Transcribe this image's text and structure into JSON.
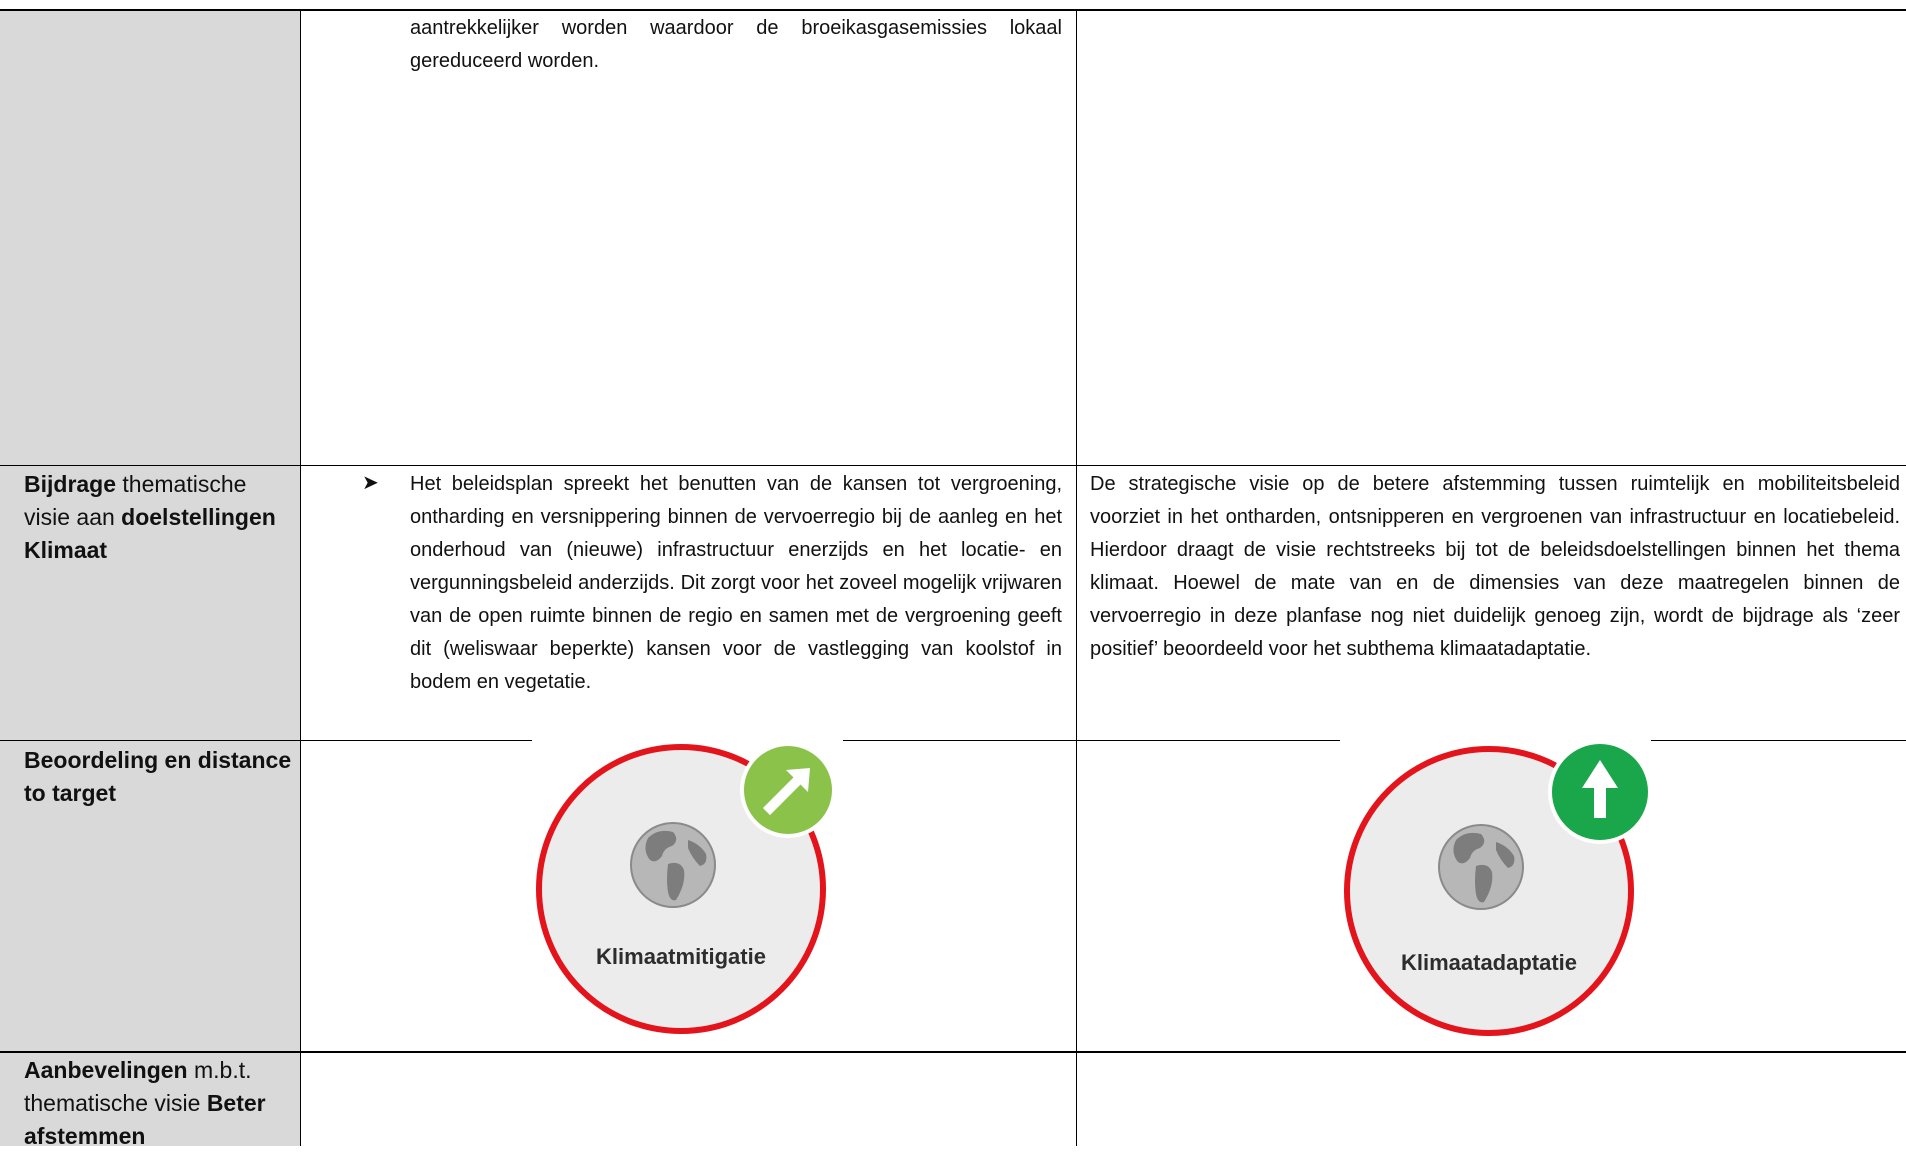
{
  "rows": {
    "top": {
      "left_text": "aantrekkelijker worden waardoor de broeikasgasemissies lokaal gereduceerd worden."
    },
    "bijdrage": {
      "label_bold1": "Bijdrage",
      "label_normal1": " thematische visie aan ",
      "label_bold2": "doelstellingen Klimaat",
      "left_text": "Het beleidsplan spreekt het benutten van de kansen tot vergroening, ontharding en versnippering binnen de vervoerregio bij de aanleg en het onderhoud van (nieuwe) infrastructuur enerzijds en het locatie- en vergunningsbeleid anderzijds. Dit zorgt voor het zoveel mogelijk vrijwaren van de open ruimte binnen de regio en samen met de vergroening geeft dit (weliswaar beperkte) kansen voor de vastlegging van koolstof in bodem en vegetatie.",
      "right_text": "De strategische visie op de betere afstemming tussen ruimtelijk en mobiliteitsbeleid voorziet in het ontharden, ontsnipperen en vergroenen van infrastructuur en locatiebeleid. Hierdoor draagt de visie rechtstreeks bij tot de beleidsdoelstellingen binnen het thema klimaat. Hoewel de mate van en de dimensies van deze maatregelen binnen de vervoerregio in deze planfase nog niet duidelijk genoeg zijn, wordt de bijdrage als ‘zeer positief’ beoordeeld voor het subthema klimaatadaptatie."
    },
    "beoordeling": {
      "label": "Beoordeling en distance to target",
      "left_badge": {
        "text": "Klimaatmitigatie",
        "arrow": "arrow-up-right-icon",
        "color": "#8bc34a"
      },
      "right_badge": {
        "text": "Klimaatadaptatie",
        "arrow": "arrow-up-icon",
        "color": "#1aa64a"
      }
    },
    "aanbevelingen": {
      "label_bold1": "Aanbevelingen",
      "label_normal1": " m.b.t. thematische visie ",
      "label_bold2": "Beter afstemmen"
    }
  }
}
